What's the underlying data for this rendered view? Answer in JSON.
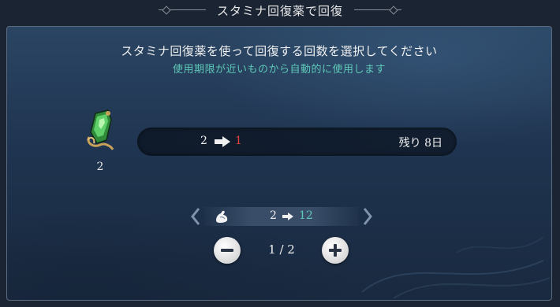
{
  "title": "スタミナ回復薬で回復",
  "heading": "スタミナ回復薬を使って回復する回数を選択してください",
  "subheading": "使用期限が近いものから自動的に使用します",
  "item": {
    "icon": "green-potion-icon",
    "count": "2"
  },
  "usage": {
    "from": "2",
    "to": "1",
    "remaining": "残り 8日"
  },
  "stamina": {
    "icon": "stamina-arm-icon",
    "from": "2",
    "to": "12"
  },
  "counter": {
    "value": "1 / 2",
    "current": 1,
    "max": 2
  },
  "colors": {
    "accent_teal": "#5ec8b8",
    "decrease_red": "#e0453a"
  }
}
